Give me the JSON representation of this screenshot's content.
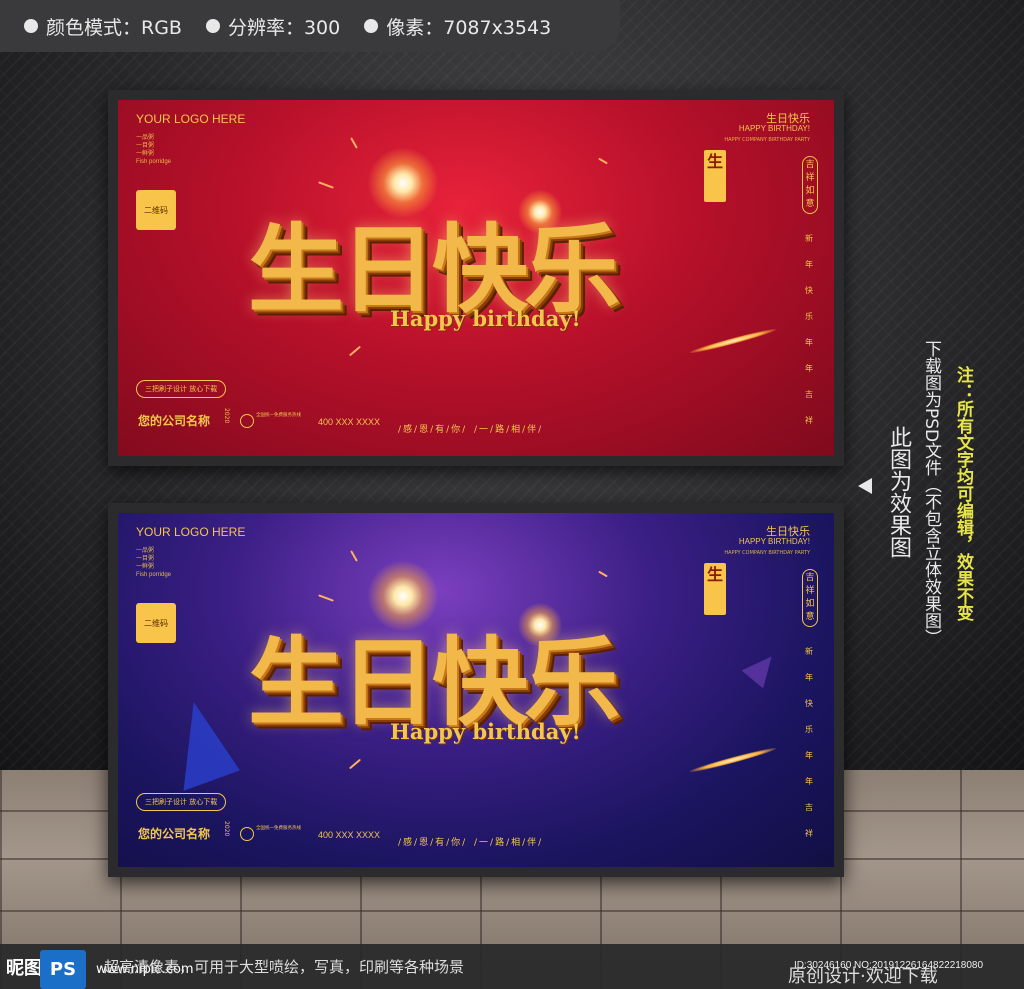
{
  "infobar": {
    "items": [
      {
        "icon": "bullet-dot",
        "text": "颜色模式：RGB"
      },
      {
        "icon": "bullet-dot",
        "text": "分辨率：300"
      },
      {
        "icon": "bullet-dot",
        "text": "像素：7087x3543"
      }
    ]
  },
  "poster": {
    "logo": "YOUR LOGO HERE",
    "tiny_lines": [
      "一品粥",
      "一目粥",
      "一鲜粥",
      "Fish porridge"
    ],
    "qr_label": "二维码",
    "top_right_cn": "生日快乐",
    "top_right_en": "HAPPY BIRTHDAY!",
    "top_right_small": "HAPPY COMPANY BIRTHDAY PARTY",
    "seal_text": "生",
    "vertical_seal": "吉祥如意",
    "vertical_line": [
      "新",
      "年",
      "快",
      "乐",
      "年",
      "年",
      "吉",
      "祥"
    ],
    "title": "生日快乐",
    "subtitle": "Happy birthday!",
    "pill": "三把刷子设计 放心下载",
    "company": "您的公司名称",
    "year": "2020",
    "small_text": "全国统一免费服务热线",
    "phone": "400 XXX XXXX",
    "slogan1": "/感/恩/有/你/",
    "slogan2": "/一/路/相/伴/"
  },
  "notes": {
    "yellow": "注：所有文字均可编辑，效果不变",
    "white": "下载图为PSD文件（不包含立体效果图）",
    "big": "此图为效果图"
  },
  "bottom": {
    "brand": "昵图网",
    "ps_label": "PS",
    "line1": "超高清像素，可用于大型喷绘，写真，印刷等各种场景",
    "url": "www.nipic.com",
    "right": "原创设计·欢迎下载",
    "id_line": "ID:30246160 NO:20191226164822218080"
  },
  "colors": {
    "gold": "#f3c64e",
    "red": "#b6102a",
    "blue": "#1b1560",
    "note_yellow": "#e7e54a"
  }
}
